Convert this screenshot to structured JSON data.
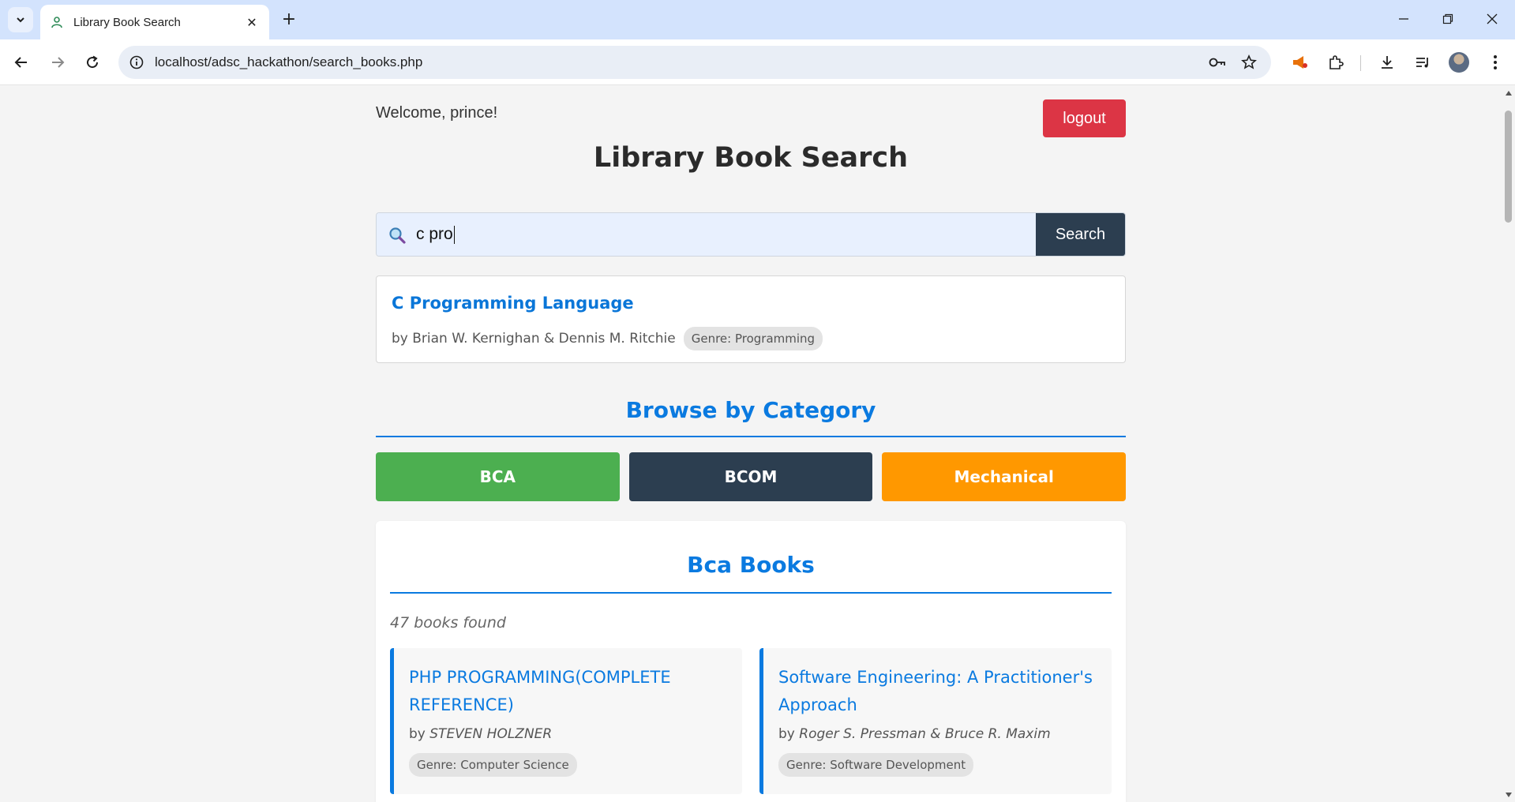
{
  "browser": {
    "tab_title": "Library Book Search",
    "url": "localhost/adsc_hackathon/search_books.php"
  },
  "header": {
    "welcome": "Welcome, prince!",
    "logout_label": "logout",
    "title": "Library Book Search"
  },
  "search": {
    "value": "c pro",
    "button_label": "Search"
  },
  "suggestion": {
    "title": "C Programming Language",
    "author": "by Brian W. Kernighan & Dennis M. Ritchie",
    "genre": "Genre: Programming"
  },
  "categories": {
    "heading": "Browse by Category",
    "items": [
      {
        "label": "BCA",
        "color": "#4caf50"
      },
      {
        "label": "BCOM",
        "color": "#2c3e50"
      },
      {
        "label": "Mechanical",
        "color": "#ff9800"
      }
    ]
  },
  "results": {
    "heading": "Bca Books",
    "count": "47 books found",
    "books": [
      {
        "title": "PHP PROGRAMMING(COMPLETE REFERENCE)",
        "by": "by ",
        "author": "STEVEN HOLZNER",
        "genre": "Genre: Computer Science"
      },
      {
        "title": "Software Engineering: A Practitioner's Approach",
        "by": "by ",
        "author": "Roger S. Pressman & Bruce R. Maxim",
        "genre": "Genre: Software Development"
      }
    ]
  },
  "colors": {
    "accent": "#0a7ae0",
    "logout": "#dc3545",
    "search_button": "#2c3e50"
  }
}
